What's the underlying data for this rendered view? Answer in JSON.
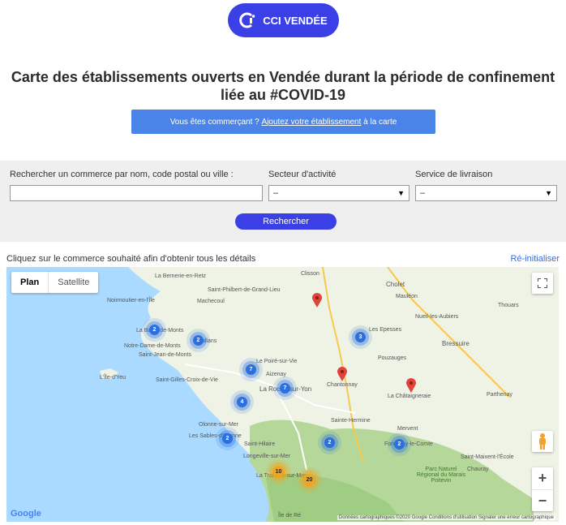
{
  "brand": {
    "name": "CCI VENDÉE",
    "color": "#3b3fe6"
  },
  "page_title": "Carte des établissements ouverts en Vendée durant la période de confinement liée au #COVID-19",
  "cta": {
    "before": "Vous êtes commerçant ? ",
    "link": "Ajoutez votre établissement",
    "after": " à la carte"
  },
  "search": {
    "name_label": "Rechercher un commerce par nom, code postal ou ville :",
    "name_value": "",
    "sector_label": "Secteur d'activité",
    "sector_value": "–",
    "delivery_label": "Service de livraison",
    "delivery_value": "–",
    "submit_label": "Rechercher"
  },
  "map": {
    "hint": "Cliquez sur le commerce souhaité afin d'obtenir tous les détails",
    "reset_label": "Ré-initialiser",
    "type_plan": "Plan",
    "type_satellite": "Satellite",
    "zoom_in": "+",
    "zoom_out": "−",
    "google": "Google",
    "attribution": "Données cartographiques ©2020 Google   Conditions d'utilisation   Signaler une erreur cartographique",
    "places": [
      "La Bernerie-en-Retz",
      "Saint-Philbert-de-Grand-Lieu",
      "Clisson",
      "Cholet",
      "Noirmoutier-en-l'Île",
      "Machecoul",
      "Mauléon",
      "Nueil-les-Aubiers",
      "La Barre-de-Monts",
      "Notre-Dame-de-Monts",
      "Challans",
      "Les Epesses",
      "Bressuire",
      "Thouars",
      "Saint-Jean-de-Monts",
      "Le Poiré-sur-Vie",
      "Aizenay",
      "Pouzauges",
      "L'Île-d'Yeu",
      "Saint-Gilles-Croix-de-Vie",
      "La Roche-sur-Yon",
      "Chantonnay",
      "La Châtaigneraie",
      "Parthenay",
      "Olonne-sur-Mer",
      "Sainte-Hermine",
      "Les Sables-d'Olonne",
      "Saint-Hilaire",
      "Mervent",
      "Fontenay-le-Comte",
      "Longeville-sur-Mer",
      "Saint-Maixent-l'École",
      "La Tranche-sur-Mer",
      "Parc Naturel Régional du Marais Poitevin",
      "Chauray",
      "Île de Ré"
    ],
    "clusters": [
      "2",
      "2",
      "3",
      "7",
      "7",
      "4",
      "2",
      "2",
      "2",
      "10",
      "20"
    ]
  }
}
